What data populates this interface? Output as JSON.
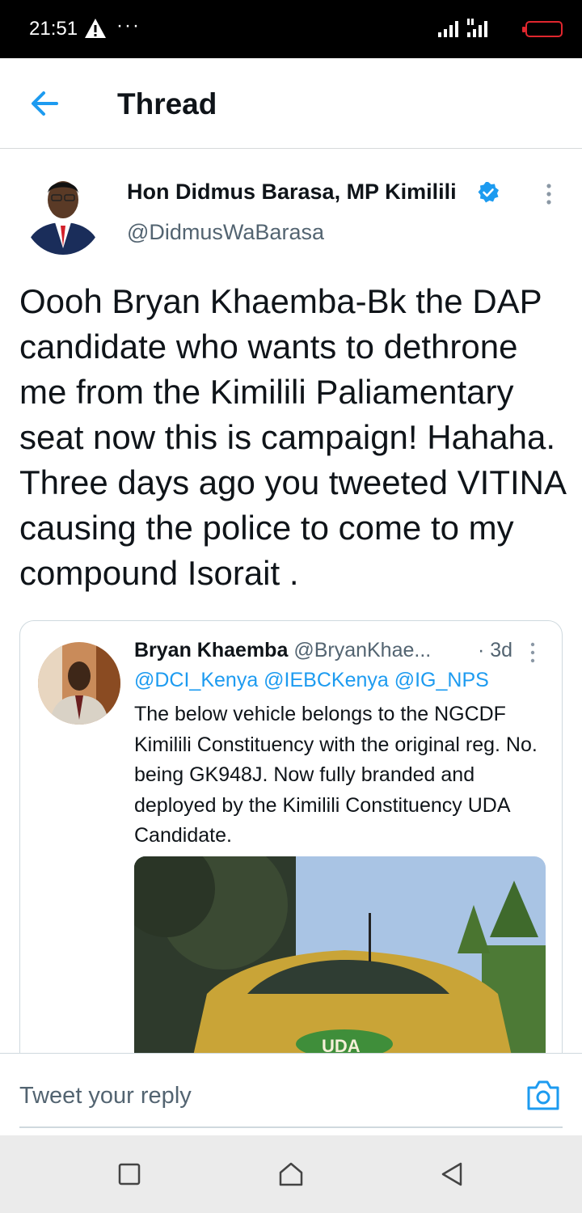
{
  "status_bar": {
    "time": "21:51",
    "overflow_dots": "···",
    "icons": [
      "warning-icon",
      "signal-icon",
      "battery-icon"
    ]
  },
  "header": {
    "title": "Thread",
    "back_icon": "arrow-left-icon"
  },
  "tweet": {
    "author_name": "Hon Didmus Barasa, MP Kimilili",
    "author_handle": "@DidmusWaBarasa",
    "verified": true,
    "text": "Oooh Bryan Khaemba-Bk the DAP candidate who wants to dethrone me from the Kimilili Paliamentary seat now this is campaign! Hahaha.  Three days ago you tweeted VITINA causing the police to come to my compound Isorait ."
  },
  "quoted_tweet": {
    "author_name": "Bryan Khaemba",
    "author_handle": "@BryanKhae...",
    "time": "· 3d",
    "mentions": "@DCI_Kenya @IEBCKenya @IG_NPS",
    "text": "The below vehicle belongs to the NGCDF Kimilili Constituency with the original reg. No. being GK948J. Now fully branded and deployed by the Kimilili Constituency UDA Candidate.",
    "image_caption": "UDA"
  },
  "reply": {
    "placeholder": "Tweet your reply",
    "camera_icon": "camera-icon"
  },
  "nav_bar": {
    "buttons": [
      "recents-square-icon",
      "home-icon",
      "back-triangle-icon"
    ]
  },
  "colors": {
    "accent": "#1d9bf0",
    "text": "#0f1419",
    "secondary": "#536471",
    "battery": "#e0262e"
  }
}
